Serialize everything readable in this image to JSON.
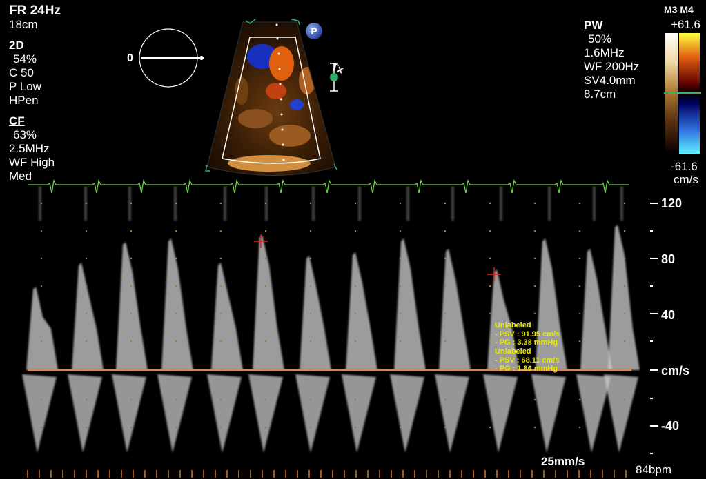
{
  "header": {
    "frame_rate": "FR 24Hz",
    "depth": "18cm",
    "probe": "M3 M4"
  },
  "mode_2d": {
    "title": "2D",
    "gain": "54%",
    "compression": "C 50",
    "power": "P Low",
    "harmonic": "HPen"
  },
  "mode_cf": {
    "title": "CF",
    "gain": "63%",
    "frequency": "2.5MHz",
    "wall_filter": "WF High",
    "level": "Med"
  },
  "mode_pw": {
    "title": "PW",
    "gain": "50%",
    "frequency": "1.6MHz",
    "wall_filter": "WF 200Hz",
    "sample_volume": "SV4.0mm",
    "depth": "8.7cm"
  },
  "color_bar": {
    "max": "+61.6",
    "min": "-61.6",
    "unit": "cm/s"
  },
  "orientation": {
    "angle": "0",
    "tx_label": "Tx",
    "p_badge": "P"
  },
  "velocity_scale": {
    "labels": [
      "120",
      "80",
      "40",
      "cm/s",
      "-40"
    ]
  },
  "measurements": [
    {
      "label": "Unlabeled",
      "psv": "- PSV : 91.95 cm/s",
      "pg": "- PG : 3.38 mmHg"
    },
    {
      "label": "Unlabeled",
      "psv": "- PSV : 68.11 cm/s",
      "pg": "- PG : 1.86 mmHg"
    }
  ],
  "footer": {
    "sweep_speed": "25mm/s",
    "heart_rate": "84bpm"
  },
  "colors": {
    "baseline": "#d9884a",
    "ecg": "#6fd24a",
    "measurement_text": "#e8e800",
    "cursor": "#e02020",
    "scale_dots": "#c07020"
  }
}
